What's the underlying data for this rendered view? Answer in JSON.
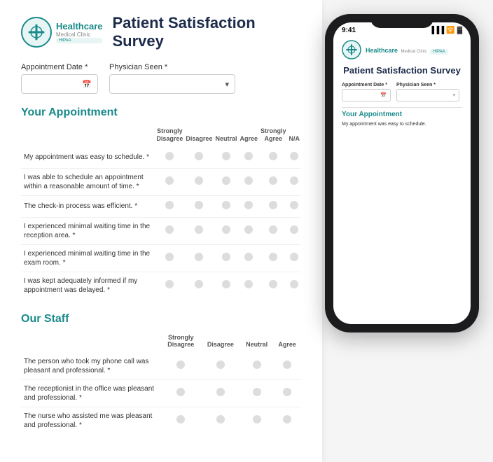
{
  "header": {
    "logo_name": "Healthcare",
    "logo_sub": "Medical Clinic",
    "badge": "HIPAA",
    "survey_title": "Patient Satisfaction Survey"
  },
  "form": {
    "appointment_date_label": "Appointment Date *",
    "appointment_date_placeholder": "",
    "physician_seen_label": "Physician Seen *",
    "physician_seen_placeholder": ""
  },
  "sections": [
    {
      "title": "Your Appointment",
      "columns": [
        "Strongly Disagree",
        "Disagree",
        "Neutral",
        "Agree",
        "Strongly Agree",
        "N/A"
      ],
      "questions": [
        "My appointment was easy to schedule. *",
        "I was able to schedule an appointment within a reasonable amount of time. *",
        "The check-in process was efficient. *",
        "I experienced minimal waiting time in the reception area. *",
        "I experienced minimal waiting time in the exam room. *",
        "I was kept adequately informed if my appointment was delayed. *"
      ]
    },
    {
      "title": "Our Staff",
      "columns": [
        "Strongly Disagree",
        "Disagree",
        "Neutral",
        "Agree"
      ],
      "questions": [
        "The person who took my phone call was pleasant and professional. *",
        "The receptionist in the office was pleasant and professional. *",
        "The nurse who assisted me was pleasant and professional. *"
      ]
    }
  ],
  "phone": {
    "time": "9:41",
    "logo_name": "Healthcare",
    "logo_sub": "Medical Clinic",
    "badge": "HIPAA",
    "survey_title": "Patient Satisfaction Survey",
    "appointment_date_label": "Appointment Date *",
    "physician_seen_label": "Physician Seen *",
    "your_appointment_title": "Your Appointment",
    "first_question": "My appointment was easy to schedule."
  },
  "colors": {
    "teal": "#1a8a8a",
    "dark_blue": "#1c2b4a",
    "light_gray": "#ddd"
  }
}
